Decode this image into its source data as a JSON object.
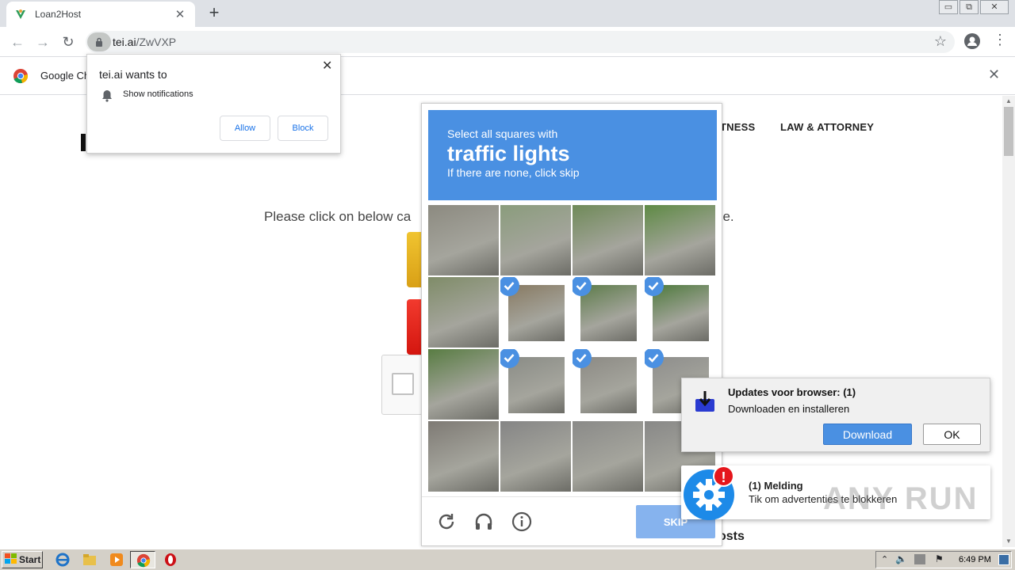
{
  "browser": {
    "tab": {
      "title": "Loan2Host"
    },
    "address": {
      "host": "tei.ai",
      "path": "/ZwVXP"
    },
    "window_controls": [
      "▭",
      "⧉",
      "✕"
    ],
    "infobar": {
      "text": "Google Ch"
    }
  },
  "site": {
    "nav": [
      "TNESS",
      "LAW & ATTORNEY"
    ],
    "instruction": "Please click on below ca",
    "instruction_tail": "ge.",
    "footer_heading": "osts"
  },
  "permission_popup": {
    "title": "tei.ai wants to",
    "permission": "Show notifications",
    "allow": "Allow",
    "block": "Block"
  },
  "captcha": {
    "line1": "Select all squares with",
    "keyword": "traffic lights",
    "line3": "If there are none, click skip",
    "skip": "SKIP",
    "icons": [
      "reload-icon",
      "headphones-icon",
      "info-icon"
    ],
    "tiles": [
      {
        "selected": false,
        "color": "#8c8a80"
      },
      {
        "selected": false,
        "color": "#8a9c7c"
      },
      {
        "selected": false,
        "color": "#6f8a58"
      },
      {
        "selected": false,
        "color": "#5e8a44"
      },
      {
        "selected": false,
        "color": "#7f8c68"
      },
      {
        "selected": true,
        "color": "#887a62"
      },
      {
        "selected": true,
        "color": "#5d7c4a"
      },
      {
        "selected": true,
        "color": "#4e7a3c"
      },
      {
        "selected": false,
        "color": "#587c42"
      },
      {
        "selected": true,
        "color": "#8a8c86"
      },
      {
        "selected": true,
        "color": "#8c8a84"
      },
      {
        "selected": true,
        "color": "#8e8e8c"
      },
      {
        "selected": false,
        "color": "#7e7a74"
      },
      {
        "selected": false,
        "color": "#858585"
      },
      {
        "selected": false,
        "color": "#8a8a88"
      },
      {
        "selected": false,
        "color": "#888887"
      }
    ]
  },
  "update_popup": {
    "title": "Updates voor browser: (1)",
    "text": "Downloaden en installeren",
    "download": "Download",
    "ok": "OK"
  },
  "melding_popup": {
    "badge": "!",
    "title": "(1) Melding",
    "text": "Tik om advertenties te blokkeren"
  },
  "watermark": "ANY RUN",
  "taskbar": {
    "start": "Start",
    "clock": "6:49 PM"
  }
}
